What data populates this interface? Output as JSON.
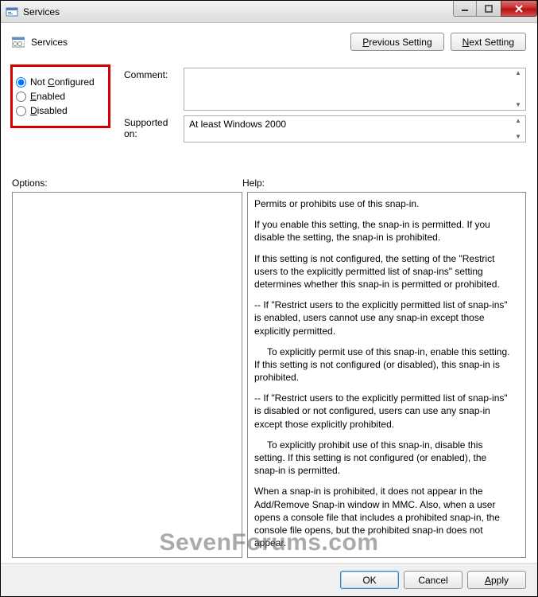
{
  "window": {
    "title": "Services"
  },
  "header": {
    "policy_name": "Services",
    "prev_button": "Previous Setting",
    "next_button": "Next Setting",
    "prev_ul": "P",
    "next_ul": "N"
  },
  "radios": {
    "not_configured": "Not Configured",
    "not_configured_ul": "C",
    "enabled": "Enabled",
    "enabled_ul": "E",
    "disabled": "Disabled",
    "disabled_ul": "D",
    "selected": "not_configured"
  },
  "fields": {
    "comment_label": "Comment:",
    "comment_value": "",
    "supported_label": "Supported on:",
    "supported_value": "At least Windows 2000"
  },
  "panels": {
    "options_label": "Options:",
    "help_label": "Help:"
  },
  "help": {
    "p1": "Permits or prohibits use of this snap-in.",
    "p2": "If you enable this setting, the snap-in is permitted. If you disable the setting, the snap-in is prohibited.",
    "p3": "If this setting is not configured, the setting of the \"Restrict users to the explicitly permitted list of snap-ins\" setting determines whether this snap-in is permitted or prohibited.",
    "p4": "--  If \"Restrict users to the explicitly permitted list of snap-ins\" is enabled, users cannot use any snap-in except those explicitly permitted.",
    "p5": "To explicitly permit use of this snap-in, enable this setting. If this setting is not configured (or disabled), this snap-in is prohibited.",
    "p6": "--  If \"Restrict users to the explicitly permitted list of snap-ins\" is disabled or not configured, users can use any snap-in except those explicitly prohibited.",
    "p7": "To explicitly prohibit use of this snap-in, disable this setting. If this setting is not configured (or enabled), the snap-in is permitted.",
    "p8": "When a snap-in is prohibited, it does not appear in the Add/Remove Snap-in window in MMC. Also, when a user opens a console file that includes a prohibited snap-in, the console file opens, but the prohibited snap-in does not appear."
  },
  "buttons": {
    "ok": "OK",
    "cancel": "Cancel",
    "apply": "Apply",
    "apply_ul": "A"
  },
  "watermark": "SevenForums.com"
}
